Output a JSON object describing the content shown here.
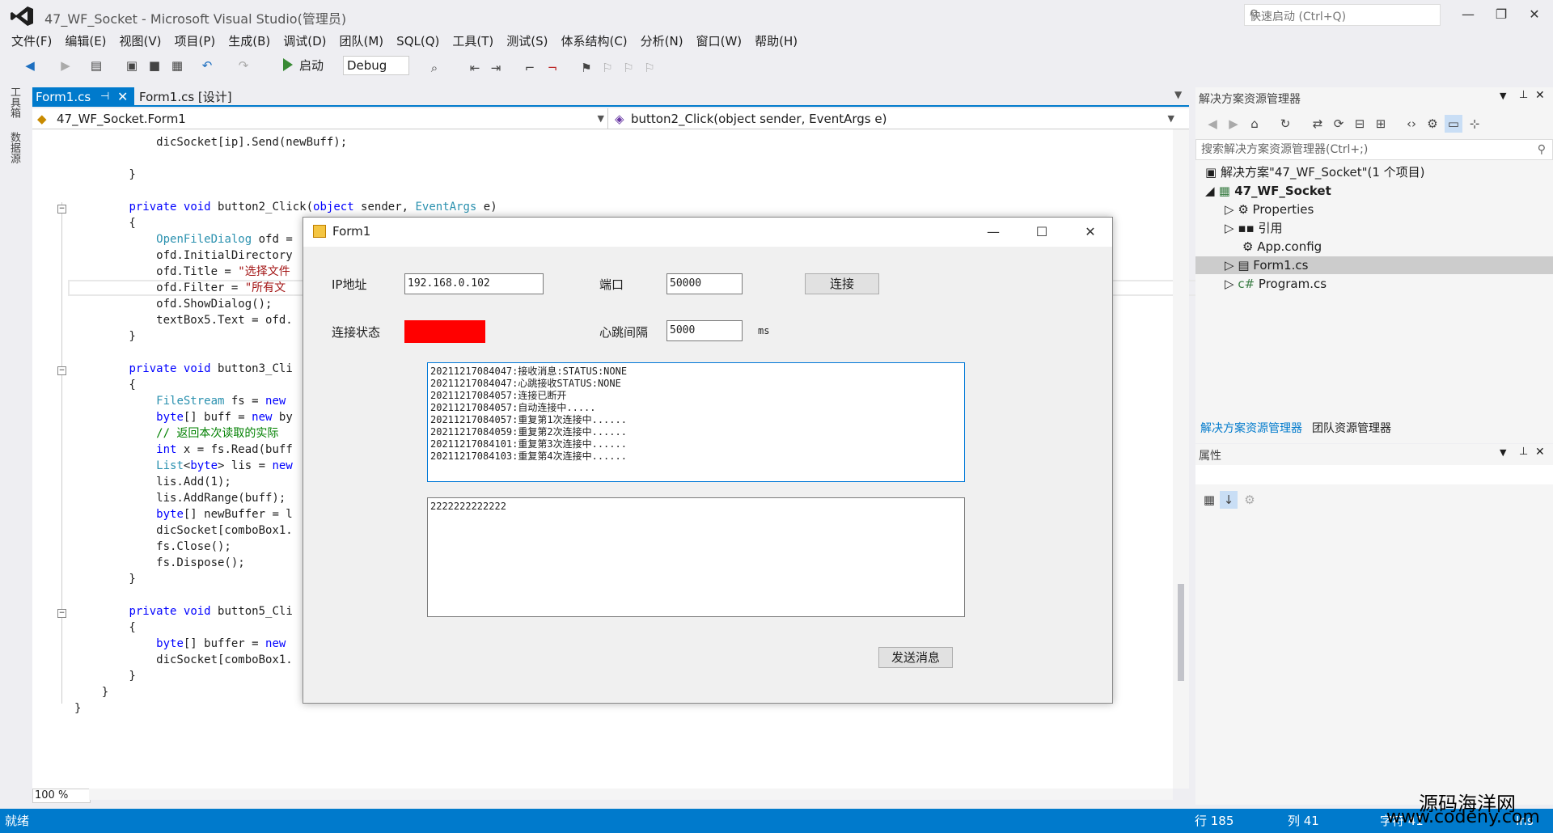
{
  "window": {
    "title": "47_WF_Socket - Microsoft Visual Studio(管理员)"
  },
  "quick_launch": {
    "placeholder": "快速启动 (Ctrl+Q)"
  },
  "menu": [
    "文件(F)",
    "编辑(E)",
    "视图(V)",
    "项目(P)",
    "生成(B)",
    "调试(D)",
    "团队(M)",
    "SQL(Q)",
    "工具(T)",
    "测试(S)",
    "体系结构(C)",
    "分析(N)",
    "窗口(W)",
    "帮助(H)"
  ],
  "toolbar": {
    "start_label": "启动",
    "config": "Debug"
  },
  "left_strip": {
    "toolbox": "工具箱",
    "datasource": "数据源"
  },
  "tabs": {
    "active": "Form1.cs",
    "inactive": "Form1.cs [设计]"
  },
  "navbar": {
    "class": "47_WF_Socket.Form1",
    "member": "button2_Click(object sender, EventArgs e)"
  },
  "code_lines": [
    "            dicSocket[ip].Send(newBuff);",
    "",
    "        }",
    "",
    "        private void button2_Click(object sender, EventArgs e)",
    "        {",
    "            OpenFileDialog ofd =",
    "            ofd.InitialDirectory",
    "            ofd.Title = \"选择文件",
    "            ofd.Filter = \"所有文",
    "            ofd.ShowDialog();",
    "            textBox5.Text = ofd.",
    "        }",
    "",
    "        private void button3_Cli",
    "        {",
    "            FileStream fs = new",
    "            byte[] buff = new by",
    "            // 返回本次读取的实际",
    "            int x = fs.Read(buff",
    "            List<byte> lis = new",
    "            lis.Add(1);",
    "            lis.AddRange(buff);",
    "            byte[] newBuffer = l",
    "            dicSocket[comboBox1.",
    "            fs.Close();",
    "            fs.Dispose();",
    "        }",
    "",
    "        private void button5_Cli",
    "        {",
    "            byte[] buffer = new",
    "            dicSocket[comboBox1.",
    "        }",
    "    }",
    "}"
  ],
  "zoom": "100 %",
  "solution_explorer": {
    "title": "解决方案资源管理器",
    "search_placeholder": "搜索解决方案资源管理器(Ctrl+;)",
    "solution": "解决方案\"47_WF_Socket\"(1 个项目)",
    "project": "47_WF_Socket",
    "items": [
      "Properties",
      "引用",
      "App.config",
      "Form1.cs",
      "Program.cs"
    ]
  },
  "panel_tabs": [
    "解决方案资源管理器",
    "团队资源管理器"
  ],
  "properties": {
    "title": "属性"
  },
  "statusbar": {
    "status": "就绪",
    "row": "行 185",
    "col": "列 41",
    "char": "字符 41",
    "ins": "Ins"
  },
  "watermark": {
    "line1": "源码海洋网",
    "line2": "www.codeny.com"
  },
  "form1": {
    "title": "Form1",
    "ip_label": "IP地址",
    "ip_value": "192.168.0.102",
    "port_label": "端口",
    "port_value": "50000",
    "connect_button": "连接",
    "status_label": "连接状态",
    "status_color": "#ff0000",
    "heartbeat_label": "心跳间隔",
    "heartbeat_value": "5000",
    "heartbeat_unit": "ms",
    "log_lines": [
      "20211217084047:接收消息:STATUS:NONE",
      "20211217084047:心跳接收STATUS:NONE",
      "20211217084057:连接已断开",
      "20211217084057:自动连接中.....",
      "20211217084057:重复第1次连接中......",
      "20211217084059:重复第2次连接中......",
      "20211217084101:重复第3次连接中......",
      "20211217084103:重复第4次连接中......"
    ],
    "message_text": "2222222222222",
    "send_button": "发送消息"
  }
}
